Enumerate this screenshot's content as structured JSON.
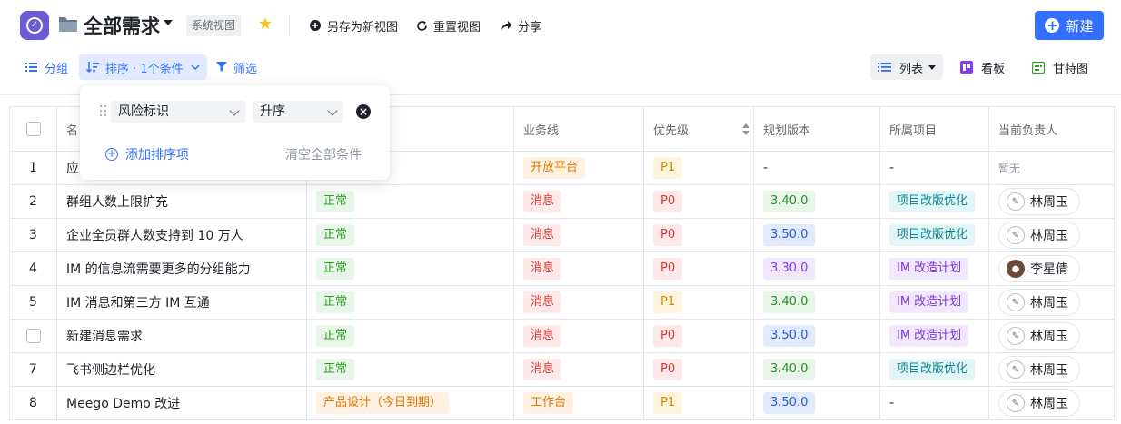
{
  "header": {
    "title": "全部需求",
    "system_view_badge": "系统视图",
    "save_as_new_view": "另存为新视图",
    "reset_view": "重置视图",
    "share": "分享",
    "new_button": "新建"
  },
  "toolbar": {
    "group": "分组",
    "sort": "排序 · 1个条件",
    "filter": "筛选",
    "view_list": "列表",
    "view_board": "看板",
    "view_gantt": "甘特图"
  },
  "sort_popover": {
    "field": "风险标识",
    "order": "升序",
    "add_sort": "添加排序项",
    "clear_all": "清空全部条件"
  },
  "table": {
    "columns": {
      "name": "名",
      "business_line": "业务线",
      "priority": "优先级",
      "version": "规划版本",
      "project": "所属项目",
      "owner": "当前负责人"
    },
    "rows": [
      {
        "idx": "1",
        "name": "应",
        "risk": "",
        "line": "开放平台",
        "priority": "P1",
        "version": "-",
        "project": "-",
        "owner": "暂无"
      },
      {
        "idx": "2",
        "name": "群组人数上限扩充",
        "risk": "正常",
        "line": "消息",
        "priority": "P0",
        "version": "3.40.0",
        "project": "项目改版优化",
        "owner": "林周玉"
      },
      {
        "idx": "3",
        "name": "企业全员群人数支持到 10 万人",
        "risk": "正常",
        "line": "消息",
        "priority": "P0",
        "version": "3.50.0",
        "project": "项目改版优化",
        "owner": "林周玉"
      },
      {
        "idx": "4",
        "name": "IM 的信息流需要更多的分组能力",
        "risk": "正常",
        "line": "消息",
        "priority": "P0",
        "version": "3.30.0",
        "project": "IM 改造计划",
        "owner": "李星倩"
      },
      {
        "idx": "5",
        "name": "IM 消息和第三方 IM 互通",
        "risk": "正常",
        "line": "消息",
        "priority": "P1",
        "version": "3.40.0",
        "project": "IM 改造计划",
        "owner": "林周玉"
      },
      {
        "idx": "",
        "name": "新建消息需求",
        "risk": "正常",
        "line": "消息",
        "priority": "P0",
        "version": "3.50.0",
        "project": "IM 改造计划",
        "owner": "林周玉"
      },
      {
        "idx": "7",
        "name": "飞书侧边栏优化",
        "risk": "正常",
        "line": "消息",
        "priority": "P0",
        "version": "3.40.0",
        "project": "项目改版优化",
        "owner": "林周玉"
      },
      {
        "idx": "8",
        "name": "Meego Demo 改进",
        "risk": "产品设计（今日到期）",
        "line": "工作台",
        "priority": "P1",
        "version": "3.50.0",
        "project": "-",
        "owner": "林周玉"
      }
    ]
  }
}
